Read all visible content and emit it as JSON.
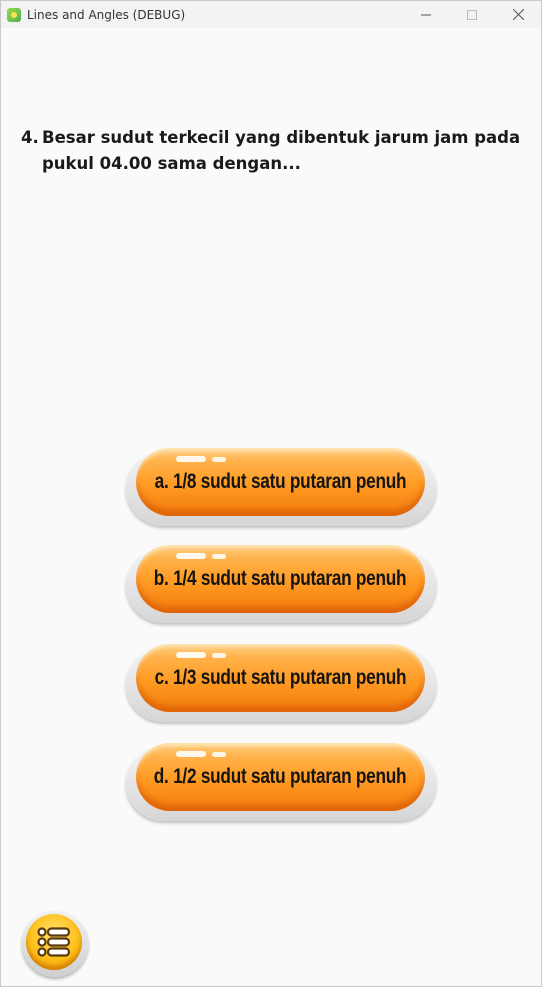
{
  "window": {
    "title": "Lines and Angles (DEBUG)"
  },
  "question": {
    "number": "4.",
    "text": "Besar sudut terkecil yang dibentuk jarum jam pada pukul 04.00 sama dengan..."
  },
  "answers": [
    {
      "label": "a. 1/8 sudut satu putaran penuh"
    },
    {
      "label": "b. 1/4 sudut satu putaran penuh"
    },
    {
      "label": "c. 1/3 sudut satu putaran penuh"
    },
    {
      "label": "d. 1/2 sudut satu putaran penuh"
    }
  ],
  "icons": {
    "app": "app-icon",
    "minimize": "minimize-icon",
    "maximize": "maximize-icon",
    "close": "close-icon",
    "menu": "menu-list-icon"
  },
  "colors": {
    "button_orange": "#ff9a22",
    "menu_yellow": "#ffbf1a"
  }
}
